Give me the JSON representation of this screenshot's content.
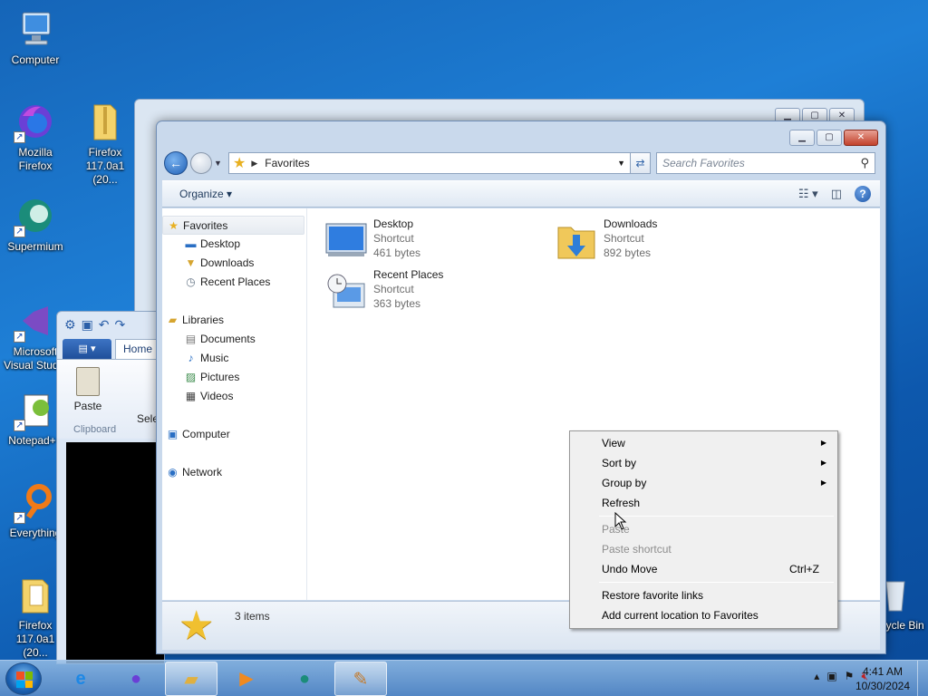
{
  "desktop": {
    "icons": [
      {
        "label": "Computer"
      },
      {
        "label": "Mozilla Firefox"
      },
      {
        "label": "Firefox 117.0a1 (20..."
      },
      {
        "label": "Supermium"
      },
      {
        "label": "Microsoft Visual Studio"
      },
      {
        "label": "Notepad++"
      },
      {
        "label": "Everything"
      },
      {
        "label": "Firefox 117.0a1 (20..."
      },
      {
        "label": "Recycle Bin"
      }
    ]
  },
  "wordpad": {
    "tab_home": "Home",
    "paste": "Paste",
    "select": "Sele",
    "group_clipboard": "Clipboard"
  },
  "explorer": {
    "address": {
      "location": "Favorites"
    },
    "search": {
      "placeholder": "Search Favorites"
    },
    "toolbar": {
      "organize": "Organize"
    },
    "nav": {
      "favorites": "Favorites",
      "desktop": "Desktop",
      "downloads": "Downloads",
      "recent_places": "Recent Places",
      "libraries": "Libraries",
      "documents": "Documents",
      "music": "Music",
      "pictures": "Pictures",
      "videos": "Videos",
      "computer": "Computer",
      "network": "Network"
    },
    "files": [
      {
        "name": "Desktop",
        "type": "Shortcut",
        "size": "461 bytes"
      },
      {
        "name": "Downloads",
        "type": "Shortcut",
        "size": "892 bytes"
      },
      {
        "name": "Recent Places",
        "type": "Shortcut",
        "size": "363 bytes"
      }
    ],
    "details": {
      "count": "3 items"
    }
  },
  "context_menu": {
    "view": "View",
    "sort_by": "Sort by",
    "group_by": "Group by",
    "refresh": "Refresh",
    "paste": "Paste",
    "paste_shortcut": "Paste shortcut",
    "undo_move": "Undo Move",
    "undo_accel": "Ctrl+Z",
    "restore_links": "Restore favorite links",
    "add_location": "Add current location to Favorites"
  },
  "taskbar": {
    "time": "4:41 AM",
    "date": "10/30/2024"
  }
}
